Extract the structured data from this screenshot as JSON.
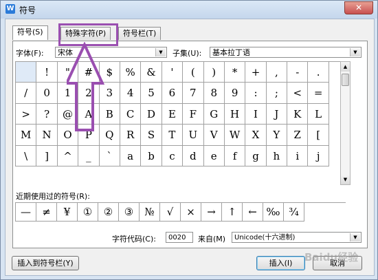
{
  "window": {
    "title": "符号",
    "app_icon": "W"
  },
  "tabs": [
    {
      "label": "符号(S)"
    },
    {
      "label": "特殊字符(P)"
    },
    {
      "label": "符号栏(T)"
    }
  ],
  "font": {
    "label": "字体(F):",
    "value": "宋体"
  },
  "subset": {
    "label": "子集(U):",
    "value": "基本拉丁语"
  },
  "symbol_grid": [
    [
      " ",
      "!",
      "\"",
      "#",
      "$",
      "%",
      "&",
      "'",
      "(",
      ")",
      "*",
      "+",
      ",",
      "-",
      "."
    ],
    [
      "/",
      "0",
      "1",
      "2",
      "3",
      "4",
      "5",
      "6",
      "7",
      "8",
      "9",
      ":",
      ";",
      "<",
      "="
    ],
    [
      ">",
      "?",
      "@",
      "A",
      "B",
      "C",
      "D",
      "E",
      "F",
      "G",
      "H",
      "I",
      "J",
      "K",
      "L"
    ],
    [
      "M",
      "N",
      "O",
      "P",
      "Q",
      "R",
      "S",
      "T",
      "U",
      "V",
      "W",
      "X",
      "Y",
      "Z",
      "["
    ],
    [
      "\\",
      "]",
      "^",
      "_",
      "`",
      "a",
      "b",
      "c",
      "d",
      "e",
      "f",
      "g",
      "h",
      "i",
      "j"
    ]
  ],
  "recent": {
    "label": "近期使用过的符号(R):",
    "symbols": [
      "—",
      "≠",
      "¥",
      "①",
      "②",
      "③",
      "№",
      "√",
      "×",
      "→",
      "↑",
      "←",
      "‰",
      "¾"
    ]
  },
  "char_code": {
    "label": "字符代码(C):",
    "value": "0020",
    "from_label": "来自(M)",
    "from_value": "Unicode(十六进制)"
  },
  "buttons": {
    "insert_to_bar": "插入到符号栏(Y)",
    "insert": "插入(I)",
    "cancel": "取消"
  },
  "watermark": "Baidu经验",
  "colors": {
    "annotation": "#9a4fb0"
  }
}
